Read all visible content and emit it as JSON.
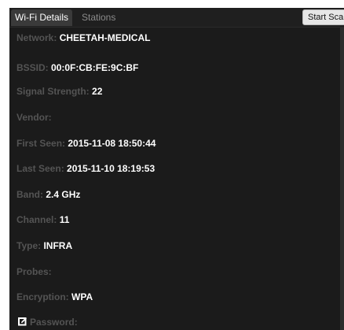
{
  "tabs": [
    {
      "label": "Wi-Fi Details"
    },
    {
      "label": "Stations"
    }
  ],
  "toolbar": {
    "start_scan_label": "Start Scan"
  },
  "details": {
    "network": {
      "label": "Network:",
      "value": "CHEETAH-MEDICAL"
    },
    "bssid": {
      "label": "BSSID:",
      "value": "00:0F:CB:FE:9C:BF"
    },
    "signal": {
      "label": "Signal Strength:",
      "value": "22"
    },
    "vendor": {
      "label": "Vendor:",
      "value": ""
    },
    "first_seen": {
      "label": "First Seen:",
      "value": "2015-11-08 18:50:44"
    },
    "last_seen": {
      "label": "Last Seen:",
      "value": "2015-11-10 18:19:53"
    },
    "band": {
      "label": "Band:",
      "value": "2.4 GHz"
    },
    "channel": {
      "label": "Channel:",
      "value": "11"
    },
    "type": {
      "label": "Type:",
      "value": "INFRA"
    },
    "probes": {
      "label": "Probes:",
      "value": ""
    },
    "encryption": {
      "label": "Encryption:",
      "value": "WPA"
    },
    "password": {
      "label": "Password:",
      "value": ""
    }
  },
  "icons": {
    "password_edit": "edit-icon"
  }
}
